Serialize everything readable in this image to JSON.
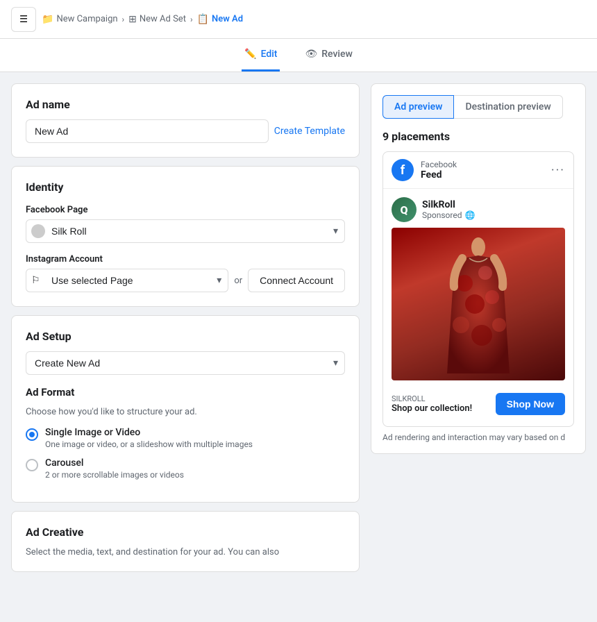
{
  "nav": {
    "toggle_icon": "☰",
    "breadcrumbs": [
      {
        "id": "new-campaign",
        "label": "New Campaign",
        "icon": "📁",
        "active": false
      },
      {
        "id": "new-ad-set",
        "label": "New Ad Set",
        "icon": "⊞",
        "active": false
      },
      {
        "id": "new-ad",
        "label": "New Ad",
        "icon": "📋",
        "active": true
      }
    ]
  },
  "tabs": [
    {
      "id": "edit",
      "label": "Edit",
      "icon": "✏️",
      "active": true
    },
    {
      "id": "review",
      "label": "Review",
      "icon": "👁",
      "active": false
    }
  ],
  "left": {
    "ad_name_section": {
      "title": "Ad name",
      "input_value": "New Ad",
      "input_placeholder": "New Ad",
      "create_template_label": "Create Template"
    },
    "identity_section": {
      "title": "Identity",
      "fb_page_label": "Facebook Page",
      "fb_page_value": "Silk Roll",
      "instagram_label": "Instagram Account",
      "instagram_value": "Use selected Page",
      "or_label": "or",
      "connect_btn_label": "Connect Account"
    },
    "ad_setup_section": {
      "title": "Ad Setup",
      "setup_value": "Create New Ad"
    },
    "ad_format_section": {
      "title": "Ad Format",
      "subtitle": "Choose how you'd like to structure your ad.",
      "options": [
        {
          "id": "single-image",
          "label": "Single Image or Video",
          "sublabel": "One image or video, or a slideshow with multiple images",
          "checked": true
        },
        {
          "id": "carousel",
          "label": "Carousel",
          "sublabel": "2 or more scrollable images or videos",
          "checked": false
        }
      ]
    },
    "ad_creative_section": {
      "title": "Ad Creative",
      "subtitle": "Select the media, text, and destination for your ad. You can also"
    }
  },
  "right": {
    "preview_tabs": [
      {
        "id": "ad-preview",
        "label": "Ad preview",
        "active": true
      },
      {
        "id": "destination-preview",
        "label": "Destination preview",
        "active": false
      }
    ],
    "placements_count": "9 placements",
    "placement": {
      "platform": "Facebook",
      "type": "Feed",
      "more_icon": "•••"
    },
    "ad": {
      "brand_name": "SilkRoll",
      "brand_avatar_letter": "Q",
      "sponsored_text": "Sponsored",
      "globe_icon": "🌐",
      "domain": "SILKROLL",
      "tagline": "Shop our collection!",
      "cta_label": "Shop Now"
    },
    "note": "Ad rendering and interaction may vary based on d"
  }
}
